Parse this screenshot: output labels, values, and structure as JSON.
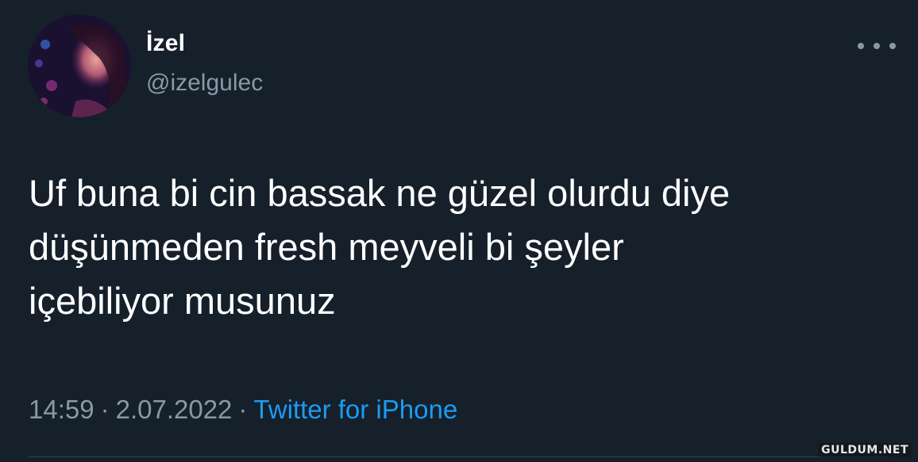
{
  "tweet": {
    "display_name": "İzel",
    "handle": "@izelgulec",
    "text_lines": [
      "Uf buna bi cin bassak ne güzel olurdu diye",
      "düşünmeden fresh meyveli bi şeyler",
      "içebiliyor musunuz"
    ],
    "time": "14:59",
    "separator": "·",
    "date": "2.07.2022",
    "source": "Twitter for iPhone",
    "more_icon": "more-horizontal-icon"
  },
  "watermark": "GULDUM.NET",
  "colors": {
    "background": "#15202b",
    "text_primary": "#ffffff",
    "text_secondary": "#8899a6",
    "link": "#1d9bf0",
    "divider": "#38444d"
  }
}
